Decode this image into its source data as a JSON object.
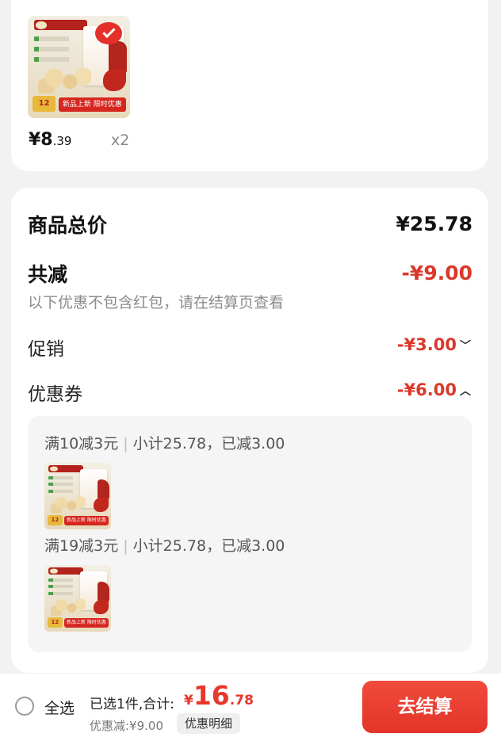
{
  "product": {
    "price_main": "¥8",
    "price_decimal": ".39",
    "quantity": "x2",
    "thumb_price": "12",
    "thumb_promo": "新品上新 限时优惠"
  },
  "summary": {
    "total_label": "商品总价",
    "total_value": "¥25.78",
    "reduce_label": "共减",
    "reduce_value": "-¥9.00",
    "reduce_hint": "以下优惠不包含红包，请在结算页查看",
    "promo_label": "促销",
    "promo_value": "-¥3.00",
    "coupon_label": "优惠券",
    "coupon_value": "-¥6.00"
  },
  "promotions": [
    {
      "rule": "满10减3元",
      "detail": "小计25.78，已减3.00"
    },
    {
      "rule": "满19减3元",
      "detail": "小计25.78，已减3.00"
    }
  ],
  "bottom": {
    "select_all": "全选",
    "selected_count": "已选1件,合计:",
    "currency": "¥",
    "total_int": "16",
    "total_dec": ".78",
    "discount": "优惠减:¥9.00",
    "detail_button": "优惠明细",
    "checkout": "去结算"
  },
  "colors": {
    "accent_red": "#d9392b",
    "checkout_button": "#e3342a",
    "background": "#f2f2f2"
  },
  "icons": {
    "chevron_down": "chevron-down-icon",
    "chevron_up": "chevron-up-icon",
    "radio": "radio-unchecked-icon"
  }
}
